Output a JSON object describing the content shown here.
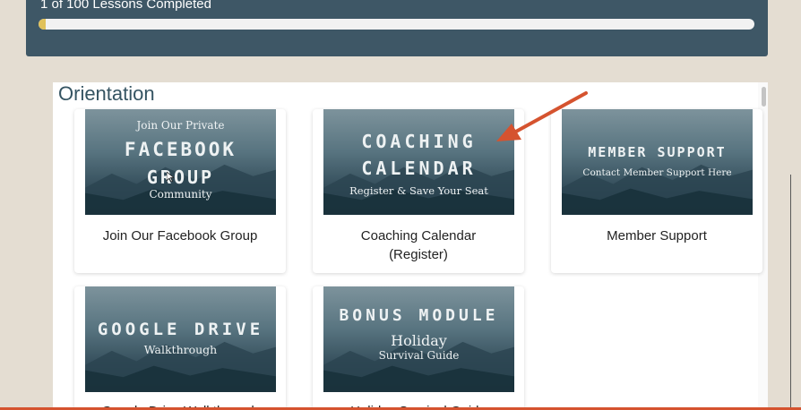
{
  "progress": {
    "label": "1 of 100 Lessons Completed",
    "completed": 1,
    "total": 100
  },
  "section": {
    "title": "Orientation"
  },
  "cards": [
    {
      "title": "Join Our Facebook Group",
      "thumb": {
        "line1": "Join Our Private",
        "line2": "FACEBOOK",
        "line3": "GROUP",
        "line4": "Community"
      }
    },
    {
      "title_line1": "Coaching Calendar",
      "title_line2": "(Register)",
      "thumb": {
        "line1": "COACHING",
        "line2": "CALENDAR",
        "line3": "Register & Save Your Seat"
      }
    },
    {
      "title": "Member Support",
      "thumb": {
        "line1": "MEMBER SUPPORT",
        "line2": "Contact Member Support Here"
      }
    },
    {
      "title": "Google Drive Walkthrough",
      "thumb": {
        "line1": "GOOGLE DRIVE",
        "line2": "Walkthrough"
      }
    },
    {
      "title": "Holiday Survival Guide",
      "thumb": {
        "line1": "BONUS MODULE",
        "line2": "Holiday",
        "line3": "Survival Guide"
      }
    }
  ],
  "colors": {
    "page_background": "#e4ddd2",
    "progress_panel": "#3e5766",
    "progress_fill": "#e0c15a",
    "section_title": "#355462",
    "annotation_arrow": "#d5532f"
  },
  "icons": {
    "annotation": "arrow-icon",
    "pointer": "cursor-icon"
  }
}
